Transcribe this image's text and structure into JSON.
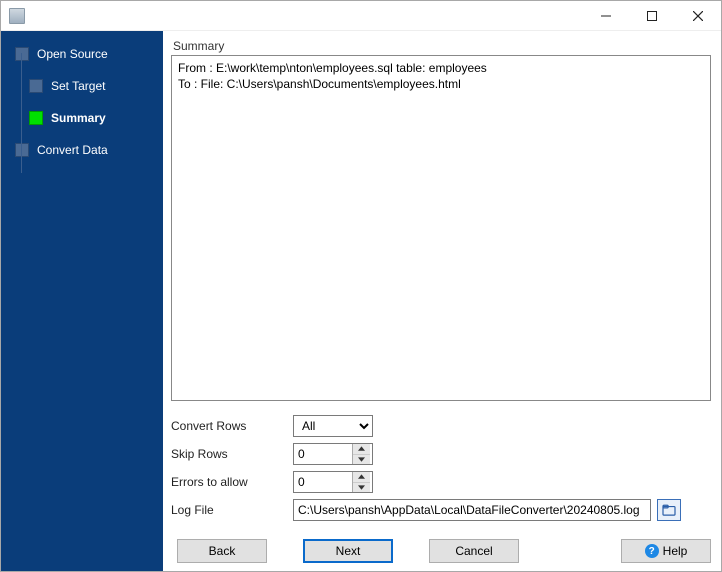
{
  "window": {
    "title": ""
  },
  "sidebar": {
    "steps": [
      {
        "label": "Open Source",
        "sub": false,
        "active": false
      },
      {
        "label": "Set Target",
        "sub": true,
        "active": false
      },
      {
        "label": "Summary",
        "sub": true,
        "active": true
      },
      {
        "label": "Convert Data",
        "sub": false,
        "active": false
      }
    ]
  },
  "main": {
    "summary_label": "Summary",
    "summary_text": "From : E:\\work\\temp\\nton\\employees.sql table: employees\nTo : File: C:\\Users\\pansh\\Documents\\employees.html",
    "rows": {
      "convert_label": "Convert Rows",
      "convert_value": "All",
      "skip_label": "Skip Rows",
      "skip_value": "0",
      "errors_label": "Errors to allow",
      "errors_value": "0",
      "log_label": "Log File",
      "log_value": "C:\\Users\\pansh\\AppData\\Local\\DataFileConverter\\20240805.log"
    }
  },
  "buttons": {
    "back": "Back",
    "next": "Next",
    "cancel": "Cancel",
    "help": "Help"
  }
}
